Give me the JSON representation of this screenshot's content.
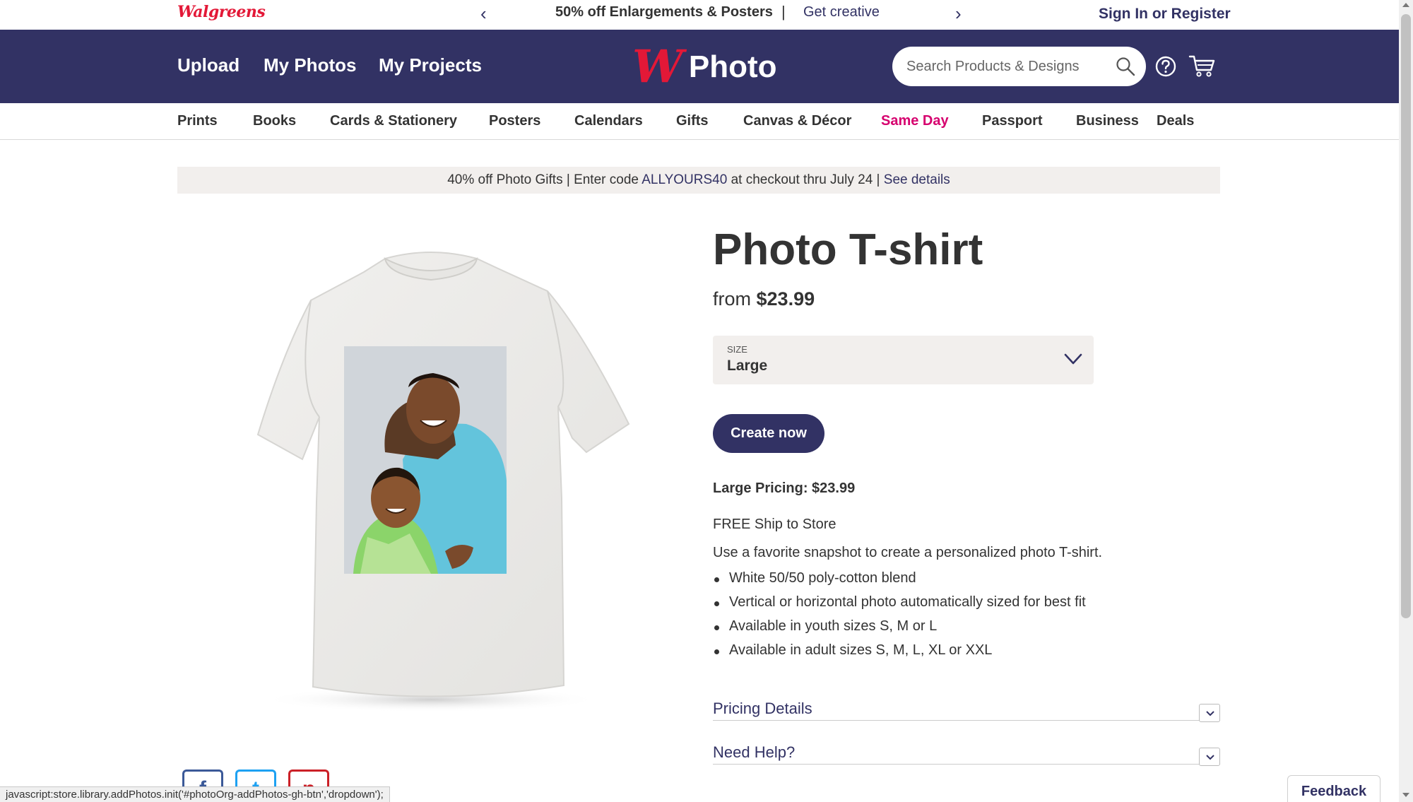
{
  "utility": {
    "logo": "Walgreens",
    "promo_text": "50% off Enlargements & Posters",
    "promo_separator": "|",
    "promo_link": "Get creative",
    "prev_glyph": "‹",
    "next_glyph": "›",
    "sign_in": "Sign In",
    "or": " or ",
    "register": "Register"
  },
  "header": {
    "nav": [
      "Upload",
      "My Photos",
      "My Projects"
    ],
    "brand_mark": "W",
    "brand_text": "Photo",
    "search_placeholder": "Search Products & Designs"
  },
  "categories": [
    "Prints",
    "Books",
    "Cards & Stationery",
    "Posters",
    "Calendars",
    "Gifts",
    "Canvas & Décor",
    "Same Day",
    "Passport",
    "Business",
    "Deals"
  ],
  "banner": {
    "before_code": "40% off Photo Gifts | Enter code ",
    "code": "ALLYOURS40",
    "after_code": " at checkout thru July 24 | ",
    "link": "See details"
  },
  "product": {
    "title": "Photo T-shirt",
    "price_prefix": "from ",
    "price": "$23.99",
    "size_label": "SIZE",
    "size_value": "Large",
    "cta": "Create now",
    "pricing_line": "Large Pricing: $23.99",
    "shipping": "FREE Ship to Store",
    "description": "Use a favorite snapshot to create a personalized photo T-shirt.",
    "features": [
      "White 50/50 poly-cotton blend",
      "Vertical or horizontal photo automatically sized for best fit",
      "Available in youth sizes S, M or L",
      "Available in adult sizes S, M, L, XL or XXL"
    ],
    "accordions": [
      "Pricing Details",
      "Need Help?"
    ]
  },
  "social": {
    "facebook": "f",
    "twitter": "t",
    "pinterest": "p"
  },
  "status_bar": "javascript:store.library.addPhotos.init('#photoOrg-addPhotos-gh-btn','dropdown');",
  "feedback": "Feedback",
  "colors": {
    "navy": "#323264",
    "brand_red": "#e31837",
    "same_day": "#d6006e",
    "banner_bg": "#f2efed"
  }
}
